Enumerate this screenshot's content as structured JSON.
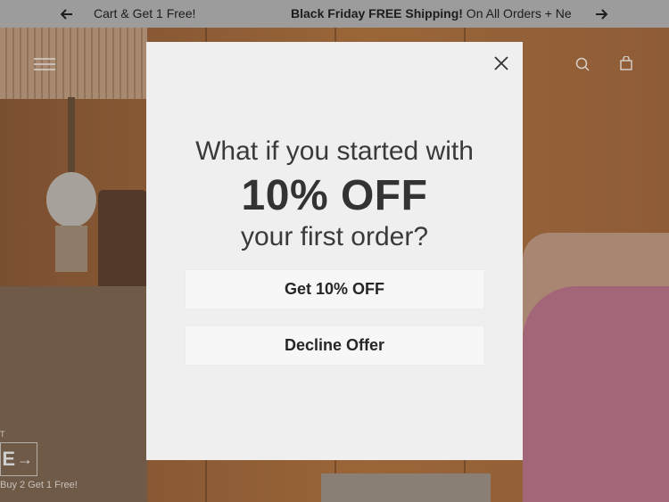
{
  "announcement": {
    "left_message_text": "Cart & Get 1 Free!",
    "right_message_bold": "Black Friday FREE Shipping!",
    "right_message_rest": " On All Orders + Ne",
    "prev_icon": "arrow-left-icon",
    "next_icon": "arrow-right-icon"
  },
  "hero": {
    "cta_letter": "E",
    "cta_arrow": "→",
    "small_text": "Buy 2 Get 1 Free!",
    "tiny_text": "T"
  },
  "header": {
    "menu_icon": "hamburger-menu-icon",
    "search_icon": "search-icon",
    "cart_icon": "shopping-bag-icon"
  },
  "modal": {
    "close_icon": "close-icon",
    "line1": "What if you started with",
    "line2": "10% OFF",
    "line3": "your first order?",
    "accept_label": "Get 10% OFF",
    "decline_label": "Decline Offer"
  },
  "colors": {
    "announcement_bg": "#9c9c9c",
    "modal_bg": "#efefef",
    "button_bg": "#f7f7f7",
    "text_dark": "#333333"
  }
}
